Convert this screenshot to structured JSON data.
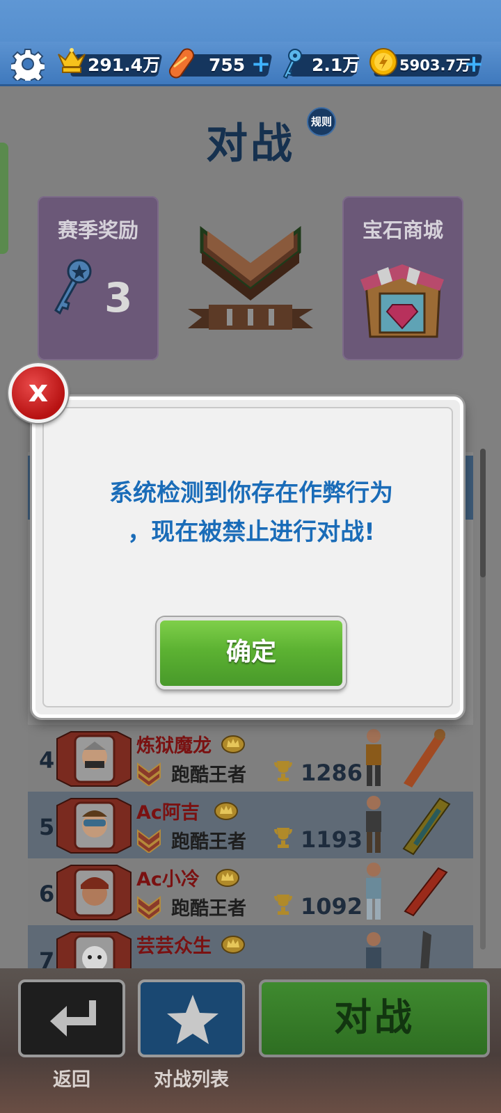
{
  "topbar": {
    "crowns": "291.4万",
    "boards": "755",
    "keys": "2.1万",
    "coins": "5903.7万",
    "plus_label": "+"
  },
  "header": {
    "title": "对战",
    "rules_label": "规则"
  },
  "cards": {
    "season_reward_title": "赛季奖励",
    "season_reward_keys": "3",
    "gem_shop_title": "宝石商城"
  },
  "leaderboard": {
    "rows": [
      {
        "rank": "4",
        "name": "炼狱魔龙",
        "tier": "跑酷王者",
        "score": "1286"
      },
      {
        "rank": "5",
        "name": "Ac阿吉",
        "tier": "跑酷王者",
        "score": "1193"
      },
      {
        "rank": "6",
        "name": "Ac小冷",
        "tier": "跑酷王者",
        "score": "1092"
      },
      {
        "rank": "7",
        "name": "芸芸众生",
        "tier": "",
        "score": ""
      }
    ]
  },
  "modal": {
    "close_label": "x",
    "message_line1": "系统检测到你存在作弊行为",
    "message_line2": "，现在被禁止进行对战!",
    "ok_label": "确定"
  },
  "bottom": {
    "back_label": "返回",
    "list_label": "对战列表",
    "fight_label": "对战"
  },
  "colors": {
    "accent_blue": "#1a6cb8",
    "ok_green": "#5cb232",
    "close_red": "#c41a1a",
    "player_name_red": "#7a1111"
  }
}
